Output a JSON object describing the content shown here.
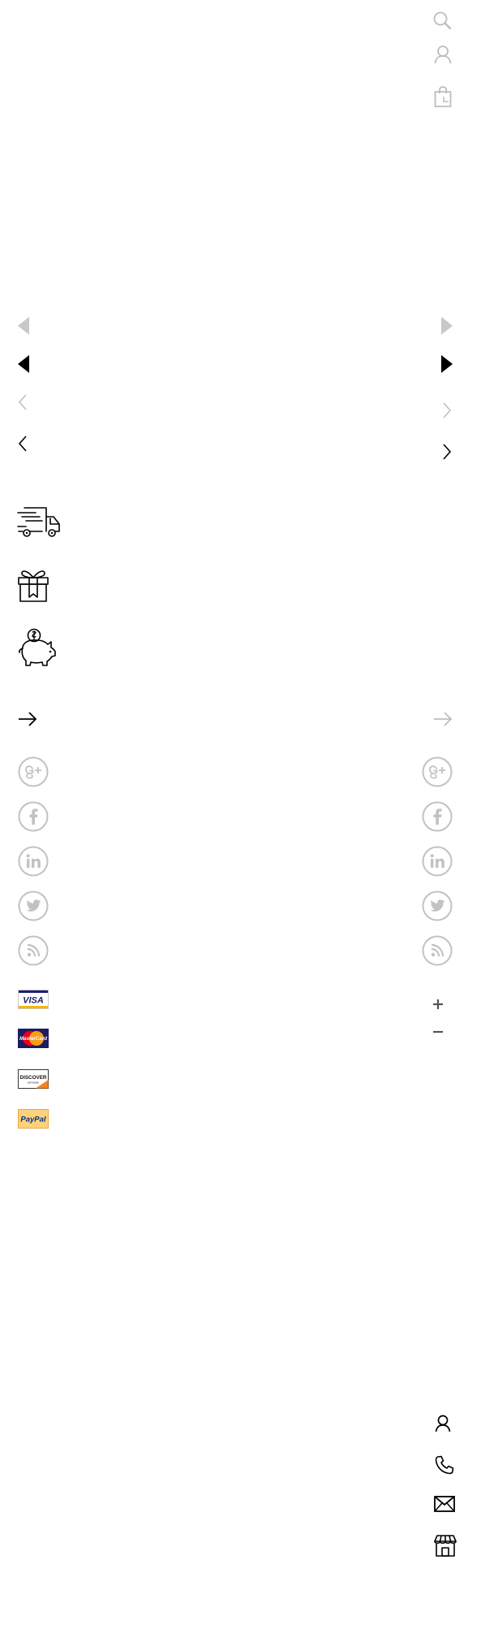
{
  "header_icons": [
    {
      "name": "search-icon",
      "color": "#bdbdbd"
    },
    {
      "name": "user-icon",
      "color": "#bdbdbd"
    },
    {
      "name": "shopping-bag-icon",
      "color": "#bdbdbd"
    }
  ],
  "slider_arrows": {
    "triangle_light": {
      "left": "triangle-left-icon",
      "right": "triangle-right-icon",
      "color": "#c8c8c8"
    },
    "triangle_dark": {
      "left": "triangle-left-icon",
      "right": "triangle-right-icon",
      "color": "#000000"
    },
    "chevron_light": {
      "left": "chevron-left-icon",
      "right": "chevron-right-icon",
      "color": "#bdbdbd"
    },
    "chevron_dark": {
      "left": "chevron-left-icon",
      "right": "chevron-right-icon",
      "color": "#000000"
    }
  },
  "feature_icons": [
    "delivery-truck-icon",
    "gift-box-icon",
    "piggy-bank-icon"
  ],
  "arrows": {
    "dark": "arrow-right-icon",
    "light": "arrow-right-icon",
    "dark_color": "#000000",
    "light_color": "#bdbdbd"
  },
  "social_icons": [
    "google-plus-icon",
    "facebook-icon",
    "linkedin-icon",
    "twitter-icon",
    "rss-icon"
  ],
  "social_color": "#c2c2c2",
  "payment_cards": {
    "visa": {
      "label": "VISA",
      "color": "#1a1f71"
    },
    "mastercard": {
      "label": "MasterCard",
      "bg": "#1c1c5e"
    },
    "discover": {
      "label": "DISCOVER",
      "sub": "NETWORK",
      "accent": "#f58220"
    },
    "paypal": {
      "label": "PayPal",
      "bg": "#ffd27a"
    }
  },
  "quantity_controls": {
    "plus": "plus-icon",
    "minus": "minus-icon",
    "color": "#555555"
  },
  "contact_icons": [
    "user-icon",
    "phone-icon",
    "envelope-icon",
    "store-icon"
  ]
}
